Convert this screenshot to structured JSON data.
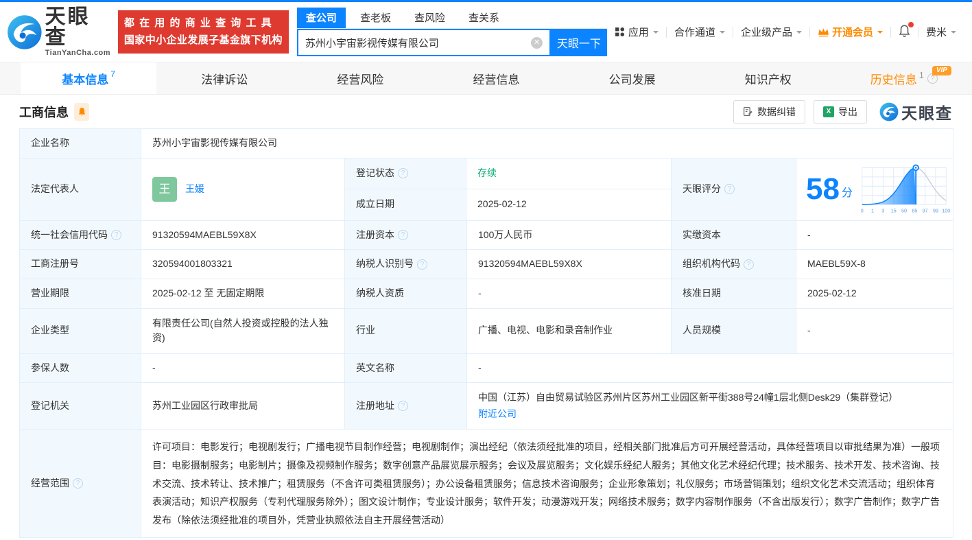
{
  "header": {
    "logo": {
      "brand": "天眼查",
      "domain": "TianYanCha.com"
    },
    "slogan": {
      "line1": "都在用的商业查询工具",
      "line2": "国家中小企业发展子基金旗下机构"
    },
    "search": {
      "tabs": [
        {
          "label": "查公司"
        },
        {
          "label": "查老板"
        },
        {
          "label": "查风险"
        },
        {
          "label": "查关系"
        }
      ],
      "value": "苏州小宇宙影视传媒有限公司",
      "button": "天眼一下"
    },
    "nav": {
      "apps": "应用",
      "partner": "合作通道",
      "enterprise": "企业级产品",
      "vip": "开通会员",
      "user": "费米"
    }
  },
  "tabs": [
    {
      "label": "基本信息",
      "badge": "7"
    },
    {
      "label": "法律诉讼"
    },
    {
      "label": "经营风险"
    },
    {
      "label": "经营信息"
    },
    {
      "label": "公司发展"
    },
    {
      "label": "知识产权"
    },
    {
      "label": "历史信息",
      "badge": "1",
      "vip": "VIP"
    }
  ],
  "section": {
    "title": "工商信息",
    "correction_btn": "数据纠错",
    "export_btn": "导出",
    "watermark": "天眼查"
  },
  "biz": {
    "company_name": {
      "label": "企业名称",
      "value": "苏州小宇宙影视传媒有限公司"
    },
    "legal_rep": {
      "label": "法定代表人",
      "name": "王媛",
      "avatar": "王"
    },
    "reg_status": {
      "label": "登记状态",
      "value": "存续"
    },
    "est_date": {
      "label": "成立日期",
      "value": "2025-02-12"
    },
    "score": {
      "label": "天眼评分"
    },
    "credit_code": {
      "label": "统一社会信用代码",
      "value": "91320594MAEBL59X8X"
    },
    "reg_capital": {
      "label": "注册资本",
      "value": "100万人民币"
    },
    "paid_capital": {
      "label": "实缴资本",
      "value": "-"
    },
    "reg_number": {
      "label": "工商注册号",
      "value": "320594001803321"
    },
    "taxpayer_id": {
      "label": "纳税人识别号",
      "value": "91320594MAEBL59X8X"
    },
    "org_code": {
      "label": "组织机构代码",
      "value": "MAEBL59X-8"
    },
    "business_term": {
      "label": "营业期限",
      "value": "2025-02-12 至 无固定期限"
    },
    "taxpayer_quality": {
      "label": "纳税人资质",
      "value": "-"
    },
    "approval_date": {
      "label": "核准日期",
      "value": "2025-02-12"
    },
    "company_type": {
      "label": "企业类型",
      "value": "有限责任公司(自然人投资或控股的法人独资)"
    },
    "industry": {
      "label": "行业",
      "value": "广播、电视、电影和录音制作业"
    },
    "staff_size": {
      "label": "人员规模",
      "value": "-"
    },
    "insured_count": {
      "label": "参保人数",
      "value": "-"
    },
    "english_name": {
      "label": "英文名称",
      "value": "-"
    },
    "reg_authority": {
      "label": "登记机关",
      "value": "苏州工业园区行政审批局"
    },
    "reg_address": {
      "label": "注册地址",
      "value": "中国（江苏）自由贸易试验区苏州片区苏州工业园区新平街388号24幢1层北侧Desk29（集群登记）",
      "link": "附近公司"
    },
    "business_scope": {
      "label": "经营范围",
      "value": "许可项目：电影发行；电视剧发行；广播电视节目制作经营；电视剧制作；演出经纪（依法须经批准的项目，经相关部门批准后方可开展经营活动，具体经营项目以审批结果为准）一般项目：电影摄制服务；电影制片；摄像及视频制作服务；数字创意产品展览展示服务；会议及展览服务；文化娱乐经纪人服务；其他文化艺术经纪代理；技术服务、技术开发、技术咨询、技术交流、技术转让、技术推广；租赁服务（不含许可类租赁服务）；办公设备租赁服务；信息技术咨询服务；企业形象策划；礼仪服务；市场营销策划；组织文化艺术交流活动；组织体育表演活动；知识产权服务（专利代理服务除外）；图文设计制作；专业设计服务；软件开发；动漫游戏开发；网络技术服务；数字内容制作服务（不含出版发行）；数字广告制作；数字广告发布（除依法须经批准的项目外，凭营业执照依法自主开展经营活动）"
    }
  },
  "chart_data": {
    "type": "area",
    "title": "天眼评分",
    "score": 58,
    "unit": "分",
    "x_ticks": [
      "0",
      "1",
      "3",
      "15",
      "50",
      "85",
      "97",
      "99",
      "100"
    ],
    "marker_fraction": 0.64,
    "curve": "normal-distribution percentile curve, blue filled to score marker",
    "accent_color": "#0d84ff"
  },
  "colors": {
    "accent_blue": "#0d84ff",
    "brand_red": "#df3a30",
    "vip_orange": "#ff8a00",
    "status_green": "#00a870",
    "label_cell_bg": "#f2f9fe",
    "cell_border": "#e3eefa"
  }
}
